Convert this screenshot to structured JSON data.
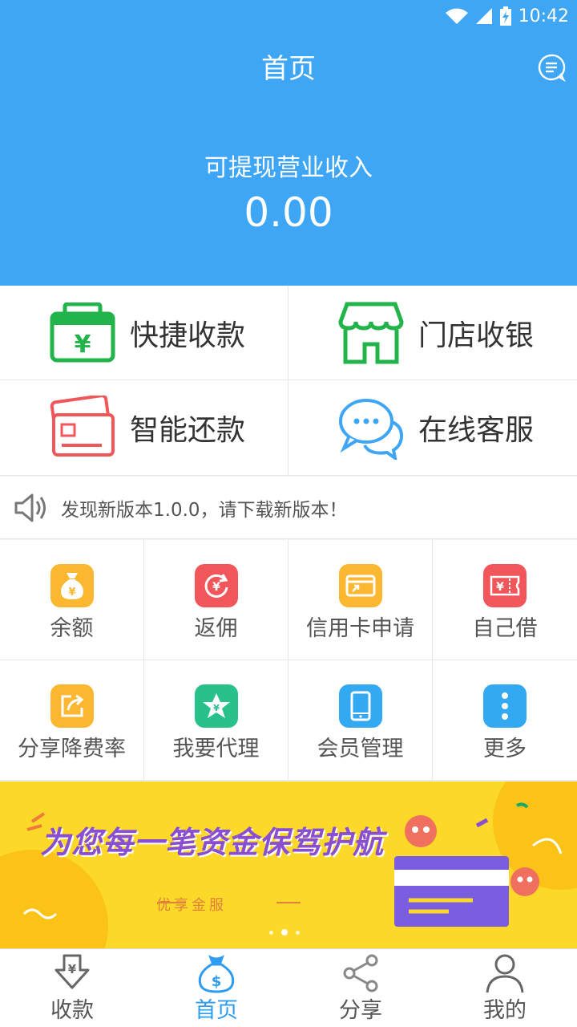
{
  "status_bar": {
    "time": "10:42"
  },
  "header": {
    "title": "首页",
    "income_label": "可提现营业收入",
    "income_value": "0.00"
  },
  "main_actions": [
    {
      "label": "快捷收款",
      "icon": "cashier-bag-icon"
    },
    {
      "label": "门店收银",
      "icon": "store-icon"
    },
    {
      "label": "智能还款",
      "icon": "credit-card-icon"
    },
    {
      "label": "在线客服",
      "icon": "chat-bubble-icon"
    }
  ],
  "notice": {
    "text": "发现新版本1.0.0，请下载新版本！"
  },
  "features": [
    {
      "label": "余额",
      "icon": "money-bag-icon",
      "color": "#fbb72f"
    },
    {
      "label": "返佣",
      "icon": "rebate-icon",
      "color": "#f0565a"
    },
    {
      "label": "信用卡申请",
      "icon": "card-apply-icon",
      "color": "#fbb72f"
    },
    {
      "label": "自己借",
      "icon": "ticket-icon",
      "color": "#f0565a"
    },
    {
      "label": "分享降费率",
      "icon": "share-icon",
      "color": "#fbb72f"
    },
    {
      "label": "我要代理",
      "icon": "agent-star-icon",
      "color": "#28c18a"
    },
    {
      "label": "会员管理",
      "icon": "phone-icon",
      "color": "#33a9f1"
    },
    {
      "label": "更多",
      "icon": "more-icon",
      "color": "#33a9f1"
    }
  ],
  "banner": {
    "slogan": "为您每一笔资金保驾护航",
    "subtitle": "优享金服"
  },
  "bottom_nav": [
    {
      "label": "收款",
      "icon": "receive-icon",
      "active": false
    },
    {
      "label": "首页",
      "icon": "home-money-bag-icon",
      "active": true
    },
    {
      "label": "分享",
      "icon": "share-nodes-icon",
      "active": false
    },
    {
      "label": "我的",
      "icon": "user-icon",
      "active": false
    }
  ],
  "colors": {
    "primary": "#3ea6f4",
    "banner": "#fcd829",
    "active_tab": "#2e9cf0"
  }
}
